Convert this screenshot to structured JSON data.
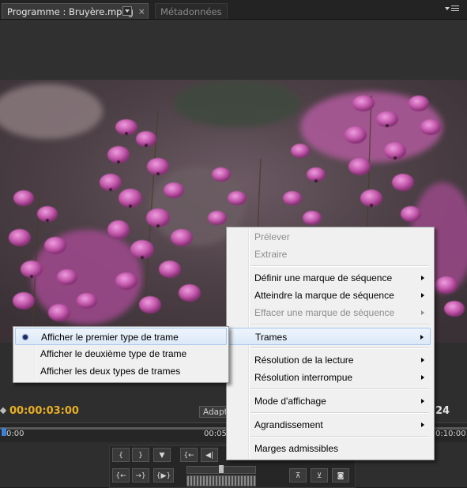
{
  "tabs": {
    "program": "Programme : Bruyère.mpeg",
    "close": "×",
    "metadata": "Métadonnées"
  },
  "monitor": {
    "timecode": "00:00:03:00",
    "fit": "Adapt",
    "duration_partial": "24",
    "ruler": [
      "0:00",
      "00:05",
      "0:10:00"
    ]
  },
  "controls": {
    "mark_in": "{",
    "mark_out": "}",
    "marker": "▼",
    "goto_in": "{←",
    "step_back": "◀|",
    "prev_edit": "{←",
    "next_edit": "→}",
    "play_in_out": "{▶}",
    "lift": "⊼",
    "extract": "⊻",
    "export_frame": "◙"
  },
  "context_menu": {
    "items": [
      {
        "label": "Prélever",
        "disabled": true
      },
      {
        "label": "Extraire",
        "disabled": true
      },
      {
        "label": "Définir une marque de séquence",
        "submenu": true
      },
      {
        "label": "Atteindre la marque de séquence",
        "submenu": true
      },
      {
        "label": "Effacer une marque de séquence",
        "submenu": true,
        "disabled": true
      },
      {
        "label": "Trames",
        "submenu": true,
        "highlighted": true
      },
      {
        "label": "Résolution de la lecture",
        "submenu": true
      },
      {
        "label": "Résolution interrompue",
        "submenu": true
      },
      {
        "label": "Mode d'affichage",
        "submenu": true
      },
      {
        "label": "Agrandissement",
        "submenu": true
      },
      {
        "label": "Marges admissibles"
      }
    ]
  },
  "submenu": {
    "items": [
      {
        "label": "Afficher le premier type de trame",
        "selected": true
      },
      {
        "label": "Afficher le deuxième type de trame"
      },
      {
        "label": "Afficher les deux types de trames"
      }
    ]
  },
  "colors": {
    "timecode": "#e8b020",
    "highlight": "#dce9f8",
    "flowers": "#c04ca8"
  }
}
